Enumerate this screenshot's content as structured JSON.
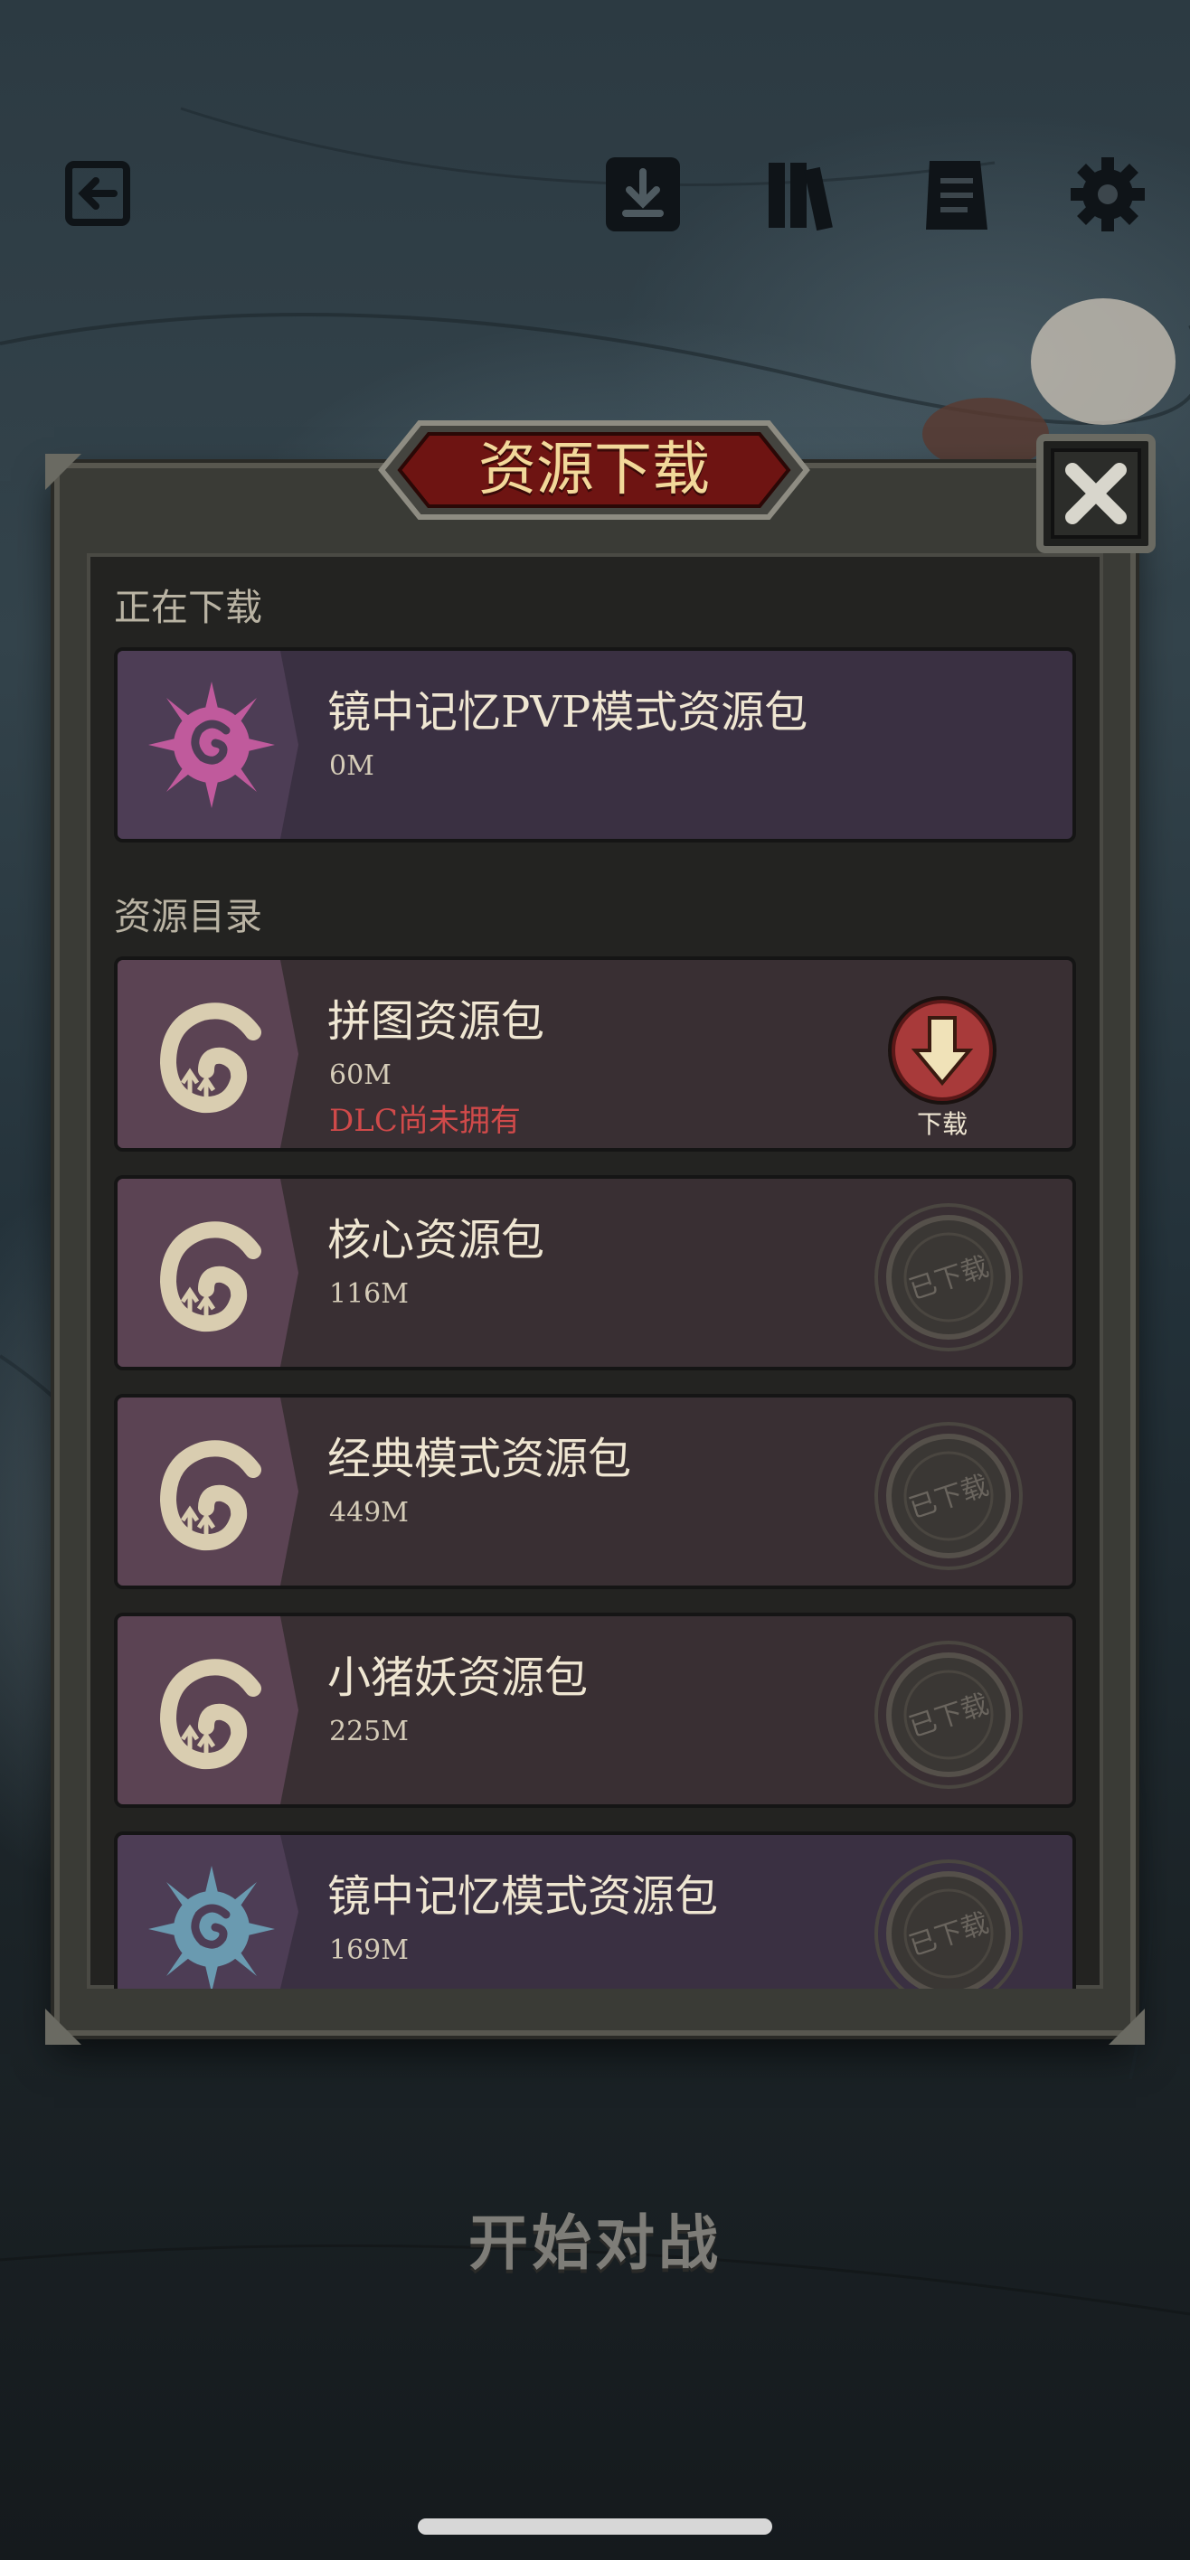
{
  "dialog": {
    "title": "资源下载"
  },
  "downloading": {
    "label": "正在下载",
    "items": [
      {
        "name": "镜中记忆PVP模式资源包",
        "size": "0M",
        "emblem": "spiky-pink-emblem-icon"
      }
    ]
  },
  "catalog": {
    "label": "资源目录",
    "items": [
      {
        "name": "拼图资源包",
        "size": "60M",
        "note": "DLC尚未拥有",
        "action": "下载",
        "status": "download"
      },
      {
        "name": "核心资源包",
        "size": "116M",
        "stamp": "已下载",
        "status": "downloaded"
      },
      {
        "name": "经典模式资源包",
        "size": "449M",
        "stamp": "已下载",
        "status": "downloaded"
      },
      {
        "name": "小猪妖资源包",
        "size": "225M",
        "stamp": "已下载",
        "status": "downloaded"
      },
      {
        "name": "镜中记忆模式资源包",
        "size": "169M",
        "stamp": "已下载",
        "status": "downloaded"
      }
    ]
  },
  "footer": {
    "start_label": "开始对战"
  },
  "icons": {
    "top_bar": [
      "exit-icon",
      "download-icon",
      "books-icon",
      "notes-icon",
      "gear-icon"
    ]
  },
  "colors": {
    "title_banner": "#6e1412",
    "title_text": "#f2d89a",
    "download_button": "#a83a3a",
    "dlc_warning": "#d04a4a"
  }
}
